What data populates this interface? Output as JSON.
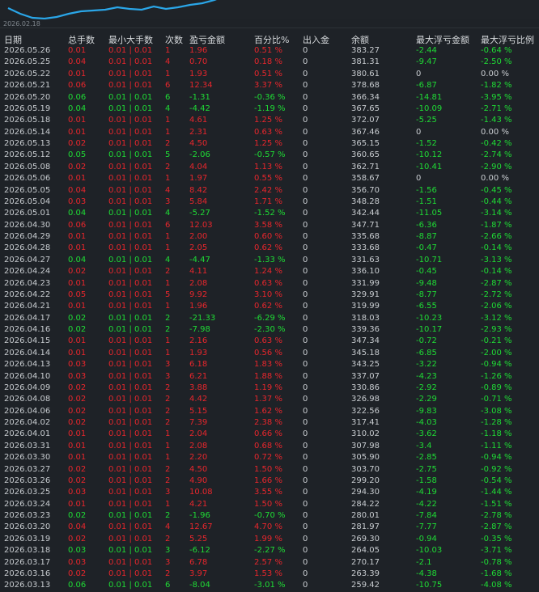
{
  "chart": {
    "date_label": "2026.02.18",
    "line_color": "#2aa6e8"
  },
  "colors": {
    "profit": "#e8262c",
    "loss": "#1fdc35",
    "neutral": "#c8ccd0"
  },
  "headers": [
    "日期",
    "总手数",
    "最小大手数",
    "次数",
    "盈亏金额",
    "百分比%",
    "出入金",
    "余额",
    "最大浮亏金额",
    "最大浮亏比例"
  ],
  "rows": [
    {
      "date": "2026.05.26",
      "lots": "0.01",
      "minmax": "0.01 | 0.01",
      "count": "1",
      "pnl": "1.96",
      "pct": "0.51 %",
      "io": "0",
      "bal": "383.27",
      "mfl": "-2.44",
      "mflp": "-0.64 %",
      "s": "r"
    },
    {
      "date": "2026.05.25",
      "lots": "0.04",
      "minmax": "0.01 | 0.01",
      "count": "4",
      "pnl": "0.70",
      "pct": "0.18 %",
      "io": "0",
      "bal": "381.31",
      "mfl": "-9.47",
      "mflp": "-2.50 %",
      "s": "r"
    },
    {
      "date": "2026.05.22",
      "lots": "0.01",
      "minmax": "0.01 | 0.01",
      "count": "1",
      "pnl": "1.93",
      "pct": "0.51 %",
      "io": "0",
      "bal": "380.61",
      "mfl": "0",
      "mflp": "0.00 %",
      "s": "r"
    },
    {
      "date": "2026.05.21",
      "lots": "0.06",
      "minmax": "0.01 | 0.01",
      "count": "6",
      "pnl": "12.34",
      "pct": "3.37 %",
      "io": "0",
      "bal": "378.68",
      "mfl": "-6.87",
      "mflp": "-1.82 %",
      "s": "r"
    },
    {
      "date": "2026.05.20",
      "lots": "0.06",
      "minmax": "0.01 | 0.01",
      "count": "6",
      "pnl": "-1.31",
      "pct": "-0.36 %",
      "io": "0",
      "bal": "366.34",
      "mfl": "-14.81",
      "mflp": "-3.95 %",
      "s": "g"
    },
    {
      "date": "2026.05.19",
      "lots": "0.04",
      "minmax": "0.01 | 0.01",
      "count": "4",
      "pnl": "-4.42",
      "pct": "-1.19 %",
      "io": "0",
      "bal": "367.65",
      "mfl": "-10.09",
      "mflp": "-2.71 %",
      "s": "g"
    },
    {
      "date": "2026.05.18",
      "lots": "0.01",
      "minmax": "0.01 | 0.01",
      "count": "1",
      "pnl": "4.61",
      "pct": "1.25 %",
      "io": "0",
      "bal": "372.07",
      "mfl": "-5.25",
      "mflp": "-1.43 %",
      "s": "r"
    },
    {
      "date": "2026.05.14",
      "lots": "0.01",
      "minmax": "0.01 | 0.01",
      "count": "1",
      "pnl": "2.31",
      "pct": "0.63 %",
      "io": "0",
      "bal": "367.46",
      "mfl": "0",
      "mflp": "0.00 %",
      "s": "r"
    },
    {
      "date": "2026.05.13",
      "lots": "0.02",
      "minmax": "0.01 | 0.01",
      "count": "2",
      "pnl": "4.50",
      "pct": "1.25 %",
      "io": "0",
      "bal": "365.15",
      "mfl": "-1.52",
      "mflp": "-0.42 %",
      "s": "r"
    },
    {
      "date": "2026.05.12",
      "lots": "0.05",
      "minmax": "0.01 | 0.01",
      "count": "5",
      "pnl": "-2.06",
      "pct": "-0.57 %",
      "io": "0",
      "bal": "360.65",
      "mfl": "-10.12",
      "mflp": "-2.74 %",
      "s": "g"
    },
    {
      "date": "2026.05.08",
      "lots": "0.02",
      "minmax": "0.01 | 0.01",
      "count": "2",
      "pnl": "4.04",
      "pct": "1.13 %",
      "io": "0",
      "bal": "362.71",
      "mfl": "-10.41",
      "mflp": "-2.90 %",
      "s": "r"
    },
    {
      "date": "2026.05.06",
      "lots": "0.01",
      "minmax": "0.01 | 0.01",
      "count": "1",
      "pnl": "1.97",
      "pct": "0.55 %",
      "io": "0",
      "bal": "358.67",
      "mfl": "0",
      "mflp": "0.00 %",
      "s": "r"
    },
    {
      "date": "2026.05.05",
      "lots": "0.04",
      "minmax": "0.01 | 0.01",
      "count": "4",
      "pnl": "8.42",
      "pct": "2.42 %",
      "io": "0",
      "bal": "356.70",
      "mfl": "-1.56",
      "mflp": "-0.45 %",
      "s": "r"
    },
    {
      "date": "2026.05.04",
      "lots": "0.03",
      "minmax": "0.01 | 0.01",
      "count": "3",
      "pnl": "5.84",
      "pct": "1.71 %",
      "io": "0",
      "bal": "348.28",
      "mfl": "-1.51",
      "mflp": "-0.44 %",
      "s": "r"
    },
    {
      "date": "2026.05.01",
      "lots": "0.04",
      "minmax": "0.01 | 0.01",
      "count": "4",
      "pnl": "-5.27",
      "pct": "-1.52 %",
      "io": "0",
      "bal": "342.44",
      "mfl": "-11.05",
      "mflp": "-3.14 %",
      "s": "g"
    },
    {
      "date": "2026.04.30",
      "lots": "0.06",
      "minmax": "0.01 | 0.01",
      "count": "6",
      "pnl": "12.03",
      "pct": "3.58 %",
      "io": "0",
      "bal": "347.71",
      "mfl": "-6.36",
      "mflp": "-1.87 %",
      "s": "r"
    },
    {
      "date": "2026.04.29",
      "lots": "0.01",
      "minmax": "0.01 | 0.01",
      "count": "1",
      "pnl": "2.00",
      "pct": "0.60 %",
      "io": "0",
      "bal": "335.68",
      "mfl": "-8.87",
      "mflp": "-2.66 %",
      "s": "r"
    },
    {
      "date": "2026.04.28",
      "lots": "0.01",
      "minmax": "0.01 | 0.01",
      "count": "1",
      "pnl": "2.05",
      "pct": "0.62 %",
      "io": "0",
      "bal": "333.68",
      "mfl": "-0.47",
      "mflp": "-0.14 %",
      "s": "r"
    },
    {
      "date": "2026.04.27",
      "lots": "0.04",
      "minmax": "0.01 | 0.01",
      "count": "4",
      "pnl": "-4.47",
      "pct": "-1.33 %",
      "io": "0",
      "bal": "331.63",
      "mfl": "-10.71",
      "mflp": "-3.13 %",
      "s": "g"
    },
    {
      "date": "2026.04.24",
      "lots": "0.02",
      "minmax": "0.01 | 0.01",
      "count": "2",
      "pnl": "4.11",
      "pct": "1.24 %",
      "io": "0",
      "bal": "336.10",
      "mfl": "-0.45",
      "mflp": "-0.14 %",
      "s": "r"
    },
    {
      "date": "2026.04.23",
      "lots": "0.01",
      "minmax": "0.01 | 0.01",
      "count": "1",
      "pnl": "2.08",
      "pct": "0.63 %",
      "io": "0",
      "bal": "331.99",
      "mfl": "-9.48",
      "mflp": "-2.87 %",
      "s": "r"
    },
    {
      "date": "2026.04.22",
      "lots": "0.05",
      "minmax": "0.01 | 0.01",
      "count": "5",
      "pnl": "9.92",
      "pct": "3.10 %",
      "io": "0",
      "bal": "329.91",
      "mfl": "-8.77",
      "mflp": "-2.72 %",
      "s": "r"
    },
    {
      "date": "2026.04.21",
      "lots": "0.01",
      "minmax": "0.01 | 0.01",
      "count": "1",
      "pnl": "1.96",
      "pct": "0.62 %",
      "io": "0",
      "bal": "319.99",
      "mfl": "-6.55",
      "mflp": "-2.06 %",
      "s": "r"
    },
    {
      "date": "2026.04.17",
      "lots": "0.02",
      "minmax": "0.01 | 0.01",
      "count": "2",
      "pnl": "-21.33",
      "pct": "-6.29 %",
      "io": "0",
      "bal": "318.03",
      "mfl": "-10.23",
      "mflp": "-3.12 %",
      "s": "g"
    },
    {
      "date": "2026.04.16",
      "lots": "0.02",
      "minmax": "0.01 | 0.01",
      "count": "2",
      "pnl": "-7.98",
      "pct": "-2.30 %",
      "io": "0",
      "bal": "339.36",
      "mfl": "-10.17",
      "mflp": "-2.93 %",
      "s": "g"
    },
    {
      "date": "2026.04.15",
      "lots": "0.01",
      "minmax": "0.01 | 0.01",
      "count": "1",
      "pnl": "2.16",
      "pct": "0.63 %",
      "io": "0",
      "bal": "347.34",
      "mfl": "-0.72",
      "mflp": "-0.21 %",
      "s": "r"
    },
    {
      "date": "2026.04.14",
      "lots": "0.01",
      "minmax": "0.01 | 0.01",
      "count": "1",
      "pnl": "1.93",
      "pct": "0.56 %",
      "io": "0",
      "bal": "345.18",
      "mfl": "-6.85",
      "mflp": "-2.00 %",
      "s": "r"
    },
    {
      "date": "2026.04.13",
      "lots": "0.03",
      "minmax": "0.01 | 0.01",
      "count": "3",
      "pnl": "6.18",
      "pct": "1.83 %",
      "io": "0",
      "bal": "343.25",
      "mfl": "-3.22",
      "mflp": "-0.94 %",
      "s": "r"
    },
    {
      "date": "2026.04.10",
      "lots": "0.03",
      "minmax": "0.01 | 0.01",
      "count": "3",
      "pnl": "6.21",
      "pct": "1.88 %",
      "io": "0",
      "bal": "337.07",
      "mfl": "-4.23",
      "mflp": "-1.26 %",
      "s": "r"
    },
    {
      "date": "2026.04.09",
      "lots": "0.02",
      "minmax": "0.01 | 0.01",
      "count": "2",
      "pnl": "3.88",
      "pct": "1.19 %",
      "io": "0",
      "bal": "330.86",
      "mfl": "-2.92",
      "mflp": "-0.89 %",
      "s": "r"
    },
    {
      "date": "2026.04.08",
      "lots": "0.02",
      "minmax": "0.01 | 0.01",
      "count": "2",
      "pnl": "4.42",
      "pct": "1.37 %",
      "io": "0",
      "bal": "326.98",
      "mfl": "-2.29",
      "mflp": "-0.71 %",
      "s": "r"
    },
    {
      "date": "2026.04.06",
      "lots": "0.02",
      "minmax": "0.01 | 0.01",
      "count": "2",
      "pnl": "5.15",
      "pct": "1.62 %",
      "io": "0",
      "bal": "322.56",
      "mfl": "-9.83",
      "mflp": "-3.08 %",
      "s": "r"
    },
    {
      "date": "2026.04.02",
      "lots": "0.02",
      "minmax": "0.01 | 0.01",
      "count": "2",
      "pnl": "7.39",
      "pct": "2.38 %",
      "io": "0",
      "bal": "317.41",
      "mfl": "-4.03",
      "mflp": "-1.28 %",
      "s": "r"
    },
    {
      "date": "2026.04.01",
      "lots": "0.01",
      "minmax": "0.01 | 0.01",
      "count": "1",
      "pnl": "2.04",
      "pct": "0.66 %",
      "io": "0",
      "bal": "310.02",
      "mfl": "-3.62",
      "mflp": "-1.18 %",
      "s": "r"
    },
    {
      "date": "2026.03.31",
      "lots": "0.01",
      "minmax": "0.01 | 0.01",
      "count": "1",
      "pnl": "2.08",
      "pct": "0.68 %",
      "io": "0",
      "bal": "307.98",
      "mfl": "-3.4",
      "mflp": "-1.11 %",
      "s": "r"
    },
    {
      "date": "2026.03.30",
      "lots": "0.01",
      "minmax": "0.01 | 0.01",
      "count": "1",
      "pnl": "2.20",
      "pct": "0.72 %",
      "io": "0",
      "bal": "305.90",
      "mfl": "-2.85",
      "mflp": "-0.94 %",
      "s": "r"
    },
    {
      "date": "2026.03.27",
      "lots": "0.02",
      "minmax": "0.01 | 0.01",
      "count": "2",
      "pnl": "4.50",
      "pct": "1.50 %",
      "io": "0",
      "bal": "303.70",
      "mfl": "-2.75",
      "mflp": "-0.92 %",
      "s": "r"
    },
    {
      "date": "2026.03.26",
      "lots": "0.02",
      "minmax": "0.01 | 0.01",
      "count": "2",
      "pnl": "4.90",
      "pct": "1.66 %",
      "io": "0",
      "bal": "299.20",
      "mfl": "-1.58",
      "mflp": "-0.54 %",
      "s": "r"
    },
    {
      "date": "2026.03.25",
      "lots": "0.03",
      "minmax": "0.01 | 0.01",
      "count": "3",
      "pnl": "10.08",
      "pct": "3.55 %",
      "io": "0",
      "bal": "294.30",
      "mfl": "-4.19",
      "mflp": "-1.44 %",
      "s": "r"
    },
    {
      "date": "2026.03.24",
      "lots": "0.01",
      "minmax": "0.01 | 0.01",
      "count": "1",
      "pnl": "4.21",
      "pct": "1.50 %",
      "io": "0",
      "bal": "284.22",
      "mfl": "-4.22",
      "mflp": "-1.51 %",
      "s": "r"
    },
    {
      "date": "2026.03.23",
      "lots": "0.02",
      "minmax": "0.01 | 0.01",
      "count": "2",
      "pnl": "-1.96",
      "pct": "-0.70 %",
      "io": "0",
      "bal": "280.01",
      "mfl": "-7.84",
      "mflp": "-2.78 %",
      "s": "g"
    },
    {
      "date": "2026.03.20",
      "lots": "0.04",
      "minmax": "0.01 | 0.01",
      "count": "4",
      "pnl": "12.67",
      "pct": "4.70 %",
      "io": "0",
      "bal": "281.97",
      "mfl": "-7.77",
      "mflp": "-2.87 %",
      "s": "r"
    },
    {
      "date": "2026.03.19",
      "lots": "0.02",
      "minmax": "0.01 | 0.01",
      "count": "2",
      "pnl": "5.25",
      "pct": "1.99 %",
      "io": "0",
      "bal": "269.30",
      "mfl": "-0.94",
      "mflp": "-0.35 %",
      "s": "r"
    },
    {
      "date": "2026.03.18",
      "lots": "0.03",
      "minmax": "0.01 | 0.01",
      "count": "3",
      "pnl": "-6.12",
      "pct": "-2.27 %",
      "io": "0",
      "bal": "264.05",
      "mfl": "-10.03",
      "mflp": "-3.71 %",
      "s": "g"
    },
    {
      "date": "2026.03.17",
      "lots": "0.03",
      "minmax": "0.01 | 0.01",
      "count": "3",
      "pnl": "6.78",
      "pct": "2.57 %",
      "io": "0",
      "bal": "270.17",
      "mfl": "-2.1",
      "mflp": "-0.78 %",
      "s": "r"
    },
    {
      "date": "2026.03.16",
      "lots": "0.02",
      "minmax": "0.01 | 0.01",
      "count": "2",
      "pnl": "3.97",
      "pct": "1.53 %",
      "io": "0",
      "bal": "263.39",
      "mfl": "-4.38",
      "mflp": "-1.68 %",
      "s": "r"
    },
    {
      "date": "2026.03.13",
      "lots": "0.06",
      "minmax": "0.01 | 0.01",
      "count": "6",
      "pnl": "-8.04",
      "pct": "-3.01 %",
      "io": "0",
      "bal": "259.42",
      "mfl": "-10.75",
      "mflp": "-4.08 %",
      "s": "g"
    }
  ]
}
